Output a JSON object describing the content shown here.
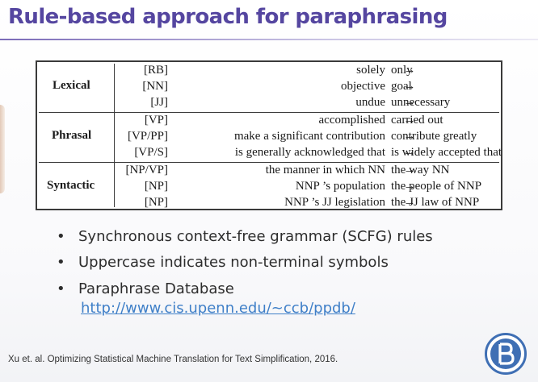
{
  "slide": {
    "title": "Rule-based approach for paraphrasing"
  },
  "table": {
    "groups": [
      {
        "category": "Lexical",
        "rows": [
          {
            "tag": "[RB]",
            "source": "solely",
            "arrow": "→",
            "target": "only"
          },
          {
            "tag": "[NN]",
            "source": "objective",
            "arrow": "→",
            "target": "goal"
          },
          {
            "tag": "[JJ]",
            "source": "undue",
            "arrow": "→",
            "target": "unnecessary"
          }
        ]
      },
      {
        "category": "Phrasal",
        "rows": [
          {
            "tag": "[VP]",
            "source": "accomplished",
            "arrow": "→",
            "target": "carried out"
          },
          {
            "tag": "[VP/PP]",
            "source": "make a significant contribution",
            "arrow": "→",
            "target": "contribute greatly"
          },
          {
            "tag": "[VP/S]",
            "source": "is generally acknowledged that",
            "arrow": "→",
            "target": "is widely accepted that"
          }
        ]
      },
      {
        "category": "Syntactic",
        "rows": [
          {
            "tag": "[NP/VP]",
            "source": "the manner in which NN",
            "arrow": "→",
            "target": "the way NN"
          },
          {
            "tag": "[NP]",
            "source": "NNP ’s population",
            "arrow": "→",
            "target": "the people of NNP"
          },
          {
            "tag": "[NP]",
            "source": "NNP ’s JJ legislation",
            "arrow": "→",
            "target": "the JJ law of NNP"
          }
        ]
      }
    ]
  },
  "bullets": {
    "marker": "•",
    "items": [
      "Synchronous context-free grammar (SCFG) rules",
      "Uppercase indicates non-terminal symbols",
      "Paraphrase Database"
    ],
    "link": "http://www.cis.upenn.edu/~ccb/ppdb/"
  },
  "citation": "Xu et. al. Optimizing Statistical Machine Translation for Text Simplification, 2016.",
  "logo": {
    "icon": "hse-university-logo",
    "color": "#3f6fb4"
  },
  "colors": {
    "title": "#5546a0",
    "link": "#3f7fc8"
  }
}
